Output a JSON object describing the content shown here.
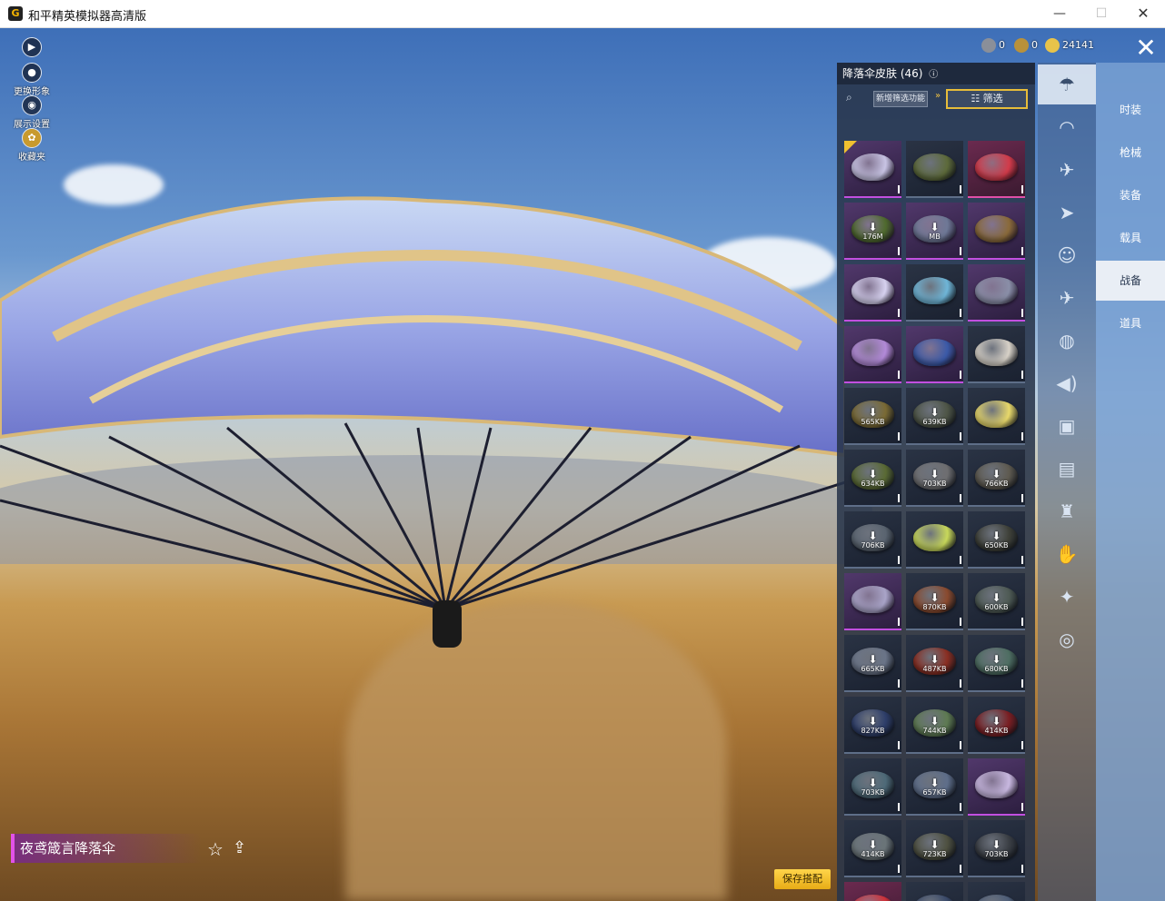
{
  "window": {
    "title": "和平精英模拟器高清版",
    "app_icon_glyph": "G",
    "controls": {
      "minimize": "—",
      "maximize": "☐",
      "close": "✕"
    }
  },
  "left_tools": [
    {
      "name": "expand",
      "icon": "▶",
      "label": ""
    },
    {
      "name": "change-avatar",
      "icon": "●",
      "label": "更换形象"
    },
    {
      "name": "display-settings",
      "icon": "◉",
      "label": "展示设置"
    },
    {
      "name": "collection",
      "icon": "✿",
      "label": "收藏夹"
    }
  ],
  "currencies": [
    {
      "name": "silver-coupon",
      "value": "0",
      "color": "#8a8f99"
    },
    {
      "name": "gold-coupon",
      "value": "0",
      "color": "#b9913a"
    },
    {
      "name": "gold-coin",
      "value": "24141",
      "color": "#e8c34a"
    }
  ],
  "close_label": "✕",
  "panel": {
    "title": "降落伞皮肤 (46)",
    "info_icon": "ⓘ",
    "search_icon": "⌕",
    "new_filter_label": "新增筛选功能",
    "arrow_mark": "»",
    "filter_label": "☷ 筛选"
  },
  "grid_items": [
    {
      "rarity": "purple",
      "chute": "#c8c4e4",
      "size": "",
      "selected": true
    },
    {
      "rarity": "dark",
      "chute": "#5d6a3a",
      "size": ""
    },
    {
      "rarity": "pink",
      "chute": "#d23b4a",
      "size": ""
    },
    {
      "rarity": "purple",
      "chute": "#4f6a2e",
      "size": "176M"
    },
    {
      "rarity": "purple",
      "chute": "#6e7896",
      "size": "MB"
    },
    {
      "rarity": "purple",
      "chute": "#8a6a3a",
      "size": ""
    },
    {
      "rarity": "purple",
      "chute": "#d7d2f0",
      "size": ""
    },
    {
      "rarity": "dark",
      "chute": "#6fb6d8",
      "size": ""
    },
    {
      "rarity": "purple",
      "chute": "#8a8fa8",
      "size": ""
    },
    {
      "rarity": "purple",
      "chute": "#b28ad8",
      "size": ""
    },
    {
      "rarity": "purple",
      "chute": "#3b5aa8",
      "size": ""
    },
    {
      "rarity": "dark",
      "chute": "#d8d2c8",
      "size": ""
    },
    {
      "rarity": "dark",
      "chute": "#7a6a34",
      "size": "565KB"
    },
    {
      "rarity": "dark",
      "chute": "#4e5546",
      "size": "639KB"
    },
    {
      "rarity": "dark",
      "chute": "#e8d86a",
      "size": ""
    },
    {
      "rarity": "dark",
      "chute": "#5a6a34",
      "size": "634KB"
    },
    {
      "rarity": "dark",
      "chute": "#6e6e70",
      "size": "703KB"
    },
    {
      "rarity": "dark",
      "chute": "#5e5a50",
      "size": "766KB"
    },
    {
      "rarity": "dark",
      "chute": "#5a6470",
      "size": "706KB"
    },
    {
      "rarity": "dark",
      "chute": "#c8d85a",
      "size": ""
    },
    {
      "rarity": "dark",
      "chute": "#3e4038",
      "size": "650KB"
    },
    {
      "rarity": "purple",
      "chute": "#a9a4c8",
      "size": ""
    },
    {
      "rarity": "dark",
      "chute": "#8a4a2e",
      "size": "870KB"
    },
    {
      "rarity": "dark",
      "chute": "#4e5a54",
      "size": "600KB"
    },
    {
      "rarity": "dark",
      "chute": "#6a7488",
      "size": "665KB"
    },
    {
      "rarity": "dark",
      "chute": "#8a2e22",
      "size": "487KB"
    },
    {
      "rarity": "dark",
      "chute": "#4e6e62",
      "size": "680KB"
    },
    {
      "rarity": "dark",
      "chute": "#2e3e6a",
      "size": "827KB"
    },
    {
      "rarity": "dark",
      "chute": "#5e7a52",
      "size": "744KB"
    },
    {
      "rarity": "dark",
      "chute": "#7a1e22",
      "size": "414KB"
    },
    {
      "rarity": "dark",
      "chute": "#4e6a78",
      "size": "703KB"
    },
    {
      "rarity": "dark",
      "chute": "#5e6e8a",
      "size": "657KB"
    },
    {
      "rarity": "purple",
      "chute": "#c8b8e0",
      "size": ""
    },
    {
      "rarity": "dark",
      "chute": "#6a7478",
      "size": "414KB"
    },
    {
      "rarity": "dark",
      "chute": "#4e5040",
      "size": "723KB"
    },
    {
      "rarity": "dark",
      "chute": "#3a3e44",
      "size": "703KB"
    },
    {
      "rarity": "pink",
      "chute": "#d0323a",
      "size": ""
    },
    {
      "rarity": "dark",
      "chute": "#3a4a6a",
      "size": ""
    },
    {
      "rarity": "dark",
      "chute": "#4e5e78",
      "size": ""
    }
  ],
  "category_icons": [
    {
      "name": "parachute-icon",
      "glyph": "☂",
      "active": true
    },
    {
      "name": "backpack-icon",
      "glyph": "◠"
    },
    {
      "name": "drone-icon",
      "glyph": "✈"
    },
    {
      "name": "glider-icon",
      "glyph": "➤"
    },
    {
      "name": "emote-icon",
      "glyph": "☺"
    },
    {
      "name": "plane-icon",
      "glyph": "✈"
    },
    {
      "name": "grenade-icon",
      "glyph": "◍"
    },
    {
      "name": "sound-icon",
      "glyph": "◀)"
    },
    {
      "name": "card-icon",
      "glyph": "▣"
    },
    {
      "name": "picture-icon",
      "glyph": "▤"
    },
    {
      "name": "extinguisher-icon",
      "glyph": "♜"
    },
    {
      "name": "glove-icon",
      "glyph": "✋"
    },
    {
      "name": "magic-wand-icon",
      "glyph": "✦"
    },
    {
      "name": "saucer-icon",
      "glyph": "◎"
    }
  ],
  "side_menu": [
    {
      "label": "时装",
      "active": false
    },
    {
      "label": "枪械",
      "active": false
    },
    {
      "label": "装备",
      "active": false
    },
    {
      "label": "载具",
      "active": false
    },
    {
      "label": "战备",
      "active": true
    },
    {
      "label": "道具",
      "active": false
    }
  ],
  "selected_item_name": "夜鸢箴言降落伞",
  "favorite_icon": "☆",
  "share_icon": "⇪",
  "save_label": "保存搭配"
}
